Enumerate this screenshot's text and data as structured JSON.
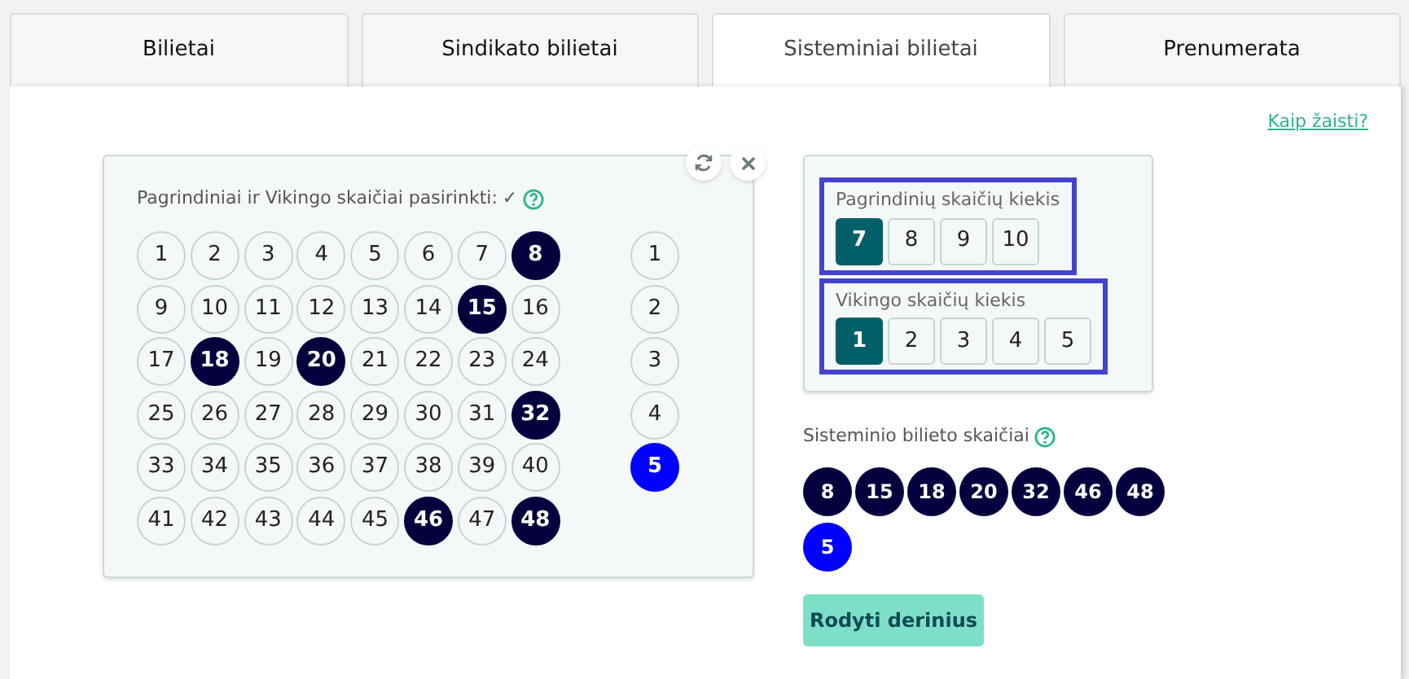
{
  "tabs": [
    {
      "label": "Bilietai",
      "selected": false
    },
    {
      "label": "Sindikato bilietai",
      "selected": false
    },
    {
      "label": "Sisteminiai bilietai",
      "selected": true
    },
    {
      "label": "Prenumerata",
      "selected": false
    }
  ],
  "help_link": "Kaip žaisti?",
  "picker": {
    "status_label": "Pagrindiniai ir Vikingo skaičiai pasirinkti:",
    "status_mark": "✓",
    "main_numbers": [
      {
        "number": "1",
        "selected": false
      },
      {
        "number": "2",
        "selected": false
      },
      {
        "number": "3",
        "selected": false
      },
      {
        "number": "4",
        "selected": false
      },
      {
        "number": "5",
        "selected": false
      },
      {
        "number": "6",
        "selected": false
      },
      {
        "number": "7",
        "selected": false
      },
      {
        "number": "8",
        "selected": true
      },
      {
        "number": "9",
        "selected": false
      },
      {
        "number": "10",
        "selected": false
      },
      {
        "number": "11",
        "selected": false
      },
      {
        "number": "12",
        "selected": false
      },
      {
        "number": "13",
        "selected": false
      },
      {
        "number": "14",
        "selected": false
      },
      {
        "number": "15",
        "selected": true
      },
      {
        "number": "16",
        "selected": false
      },
      {
        "number": "17",
        "selected": false
      },
      {
        "number": "18",
        "selected": true
      },
      {
        "number": "19",
        "selected": false
      },
      {
        "number": "20",
        "selected": true
      },
      {
        "number": "21",
        "selected": false
      },
      {
        "number": "22",
        "selected": false
      },
      {
        "number": "23",
        "selected": false
      },
      {
        "number": "24",
        "selected": false
      },
      {
        "number": "25",
        "selected": false
      },
      {
        "number": "26",
        "selected": false
      },
      {
        "number": "27",
        "selected": false
      },
      {
        "number": "28",
        "selected": false
      },
      {
        "number": "29",
        "selected": false
      },
      {
        "number": "30",
        "selected": false
      },
      {
        "number": "31",
        "selected": false
      },
      {
        "number": "32",
        "selected": true
      },
      {
        "number": "33",
        "selected": false
      },
      {
        "number": "34",
        "selected": false
      },
      {
        "number": "35",
        "selected": false
      },
      {
        "number": "36",
        "selected": false
      },
      {
        "number": "37",
        "selected": false
      },
      {
        "number": "38",
        "selected": false
      },
      {
        "number": "39",
        "selected": false
      },
      {
        "number": "40",
        "selected": false
      },
      {
        "number": "41",
        "selected": false
      },
      {
        "number": "42",
        "selected": false
      },
      {
        "number": "43",
        "selected": false
      },
      {
        "number": "44",
        "selected": false
      },
      {
        "number": "45",
        "selected": false
      },
      {
        "number": "46",
        "selected": true
      },
      {
        "number": "47",
        "selected": false
      },
      {
        "number": "48",
        "selected": true
      }
    ],
    "viking_numbers": [
      {
        "number": "1",
        "selected": false
      },
      {
        "number": "2",
        "selected": false
      },
      {
        "number": "3",
        "selected": false
      },
      {
        "number": "4",
        "selected": false
      },
      {
        "number": "5",
        "selected": true
      }
    ]
  },
  "settings": {
    "main_count": {
      "label": "Pagrindinių skaičių kiekis",
      "options": [
        {
          "label": "7",
          "selected": true
        },
        {
          "label": "8",
          "selected": false
        },
        {
          "label": "9",
          "selected": false
        },
        {
          "label": "10",
          "selected": false
        }
      ]
    },
    "viking_count": {
      "label": "Vikingo skaičių kiekis",
      "options": [
        {
          "label": "1",
          "selected": true
        },
        {
          "label": "2",
          "selected": false
        },
        {
          "label": "3",
          "selected": false
        },
        {
          "label": "4",
          "selected": false
        },
        {
          "label": "5",
          "selected": false
        }
      ]
    }
  },
  "result": {
    "label": "Sisteminio bilieto skaičiai",
    "main": [
      "8",
      "15",
      "18",
      "20",
      "32",
      "46",
      "48"
    ],
    "viking": [
      "5"
    ]
  },
  "button": "Rodyti derinius"
}
